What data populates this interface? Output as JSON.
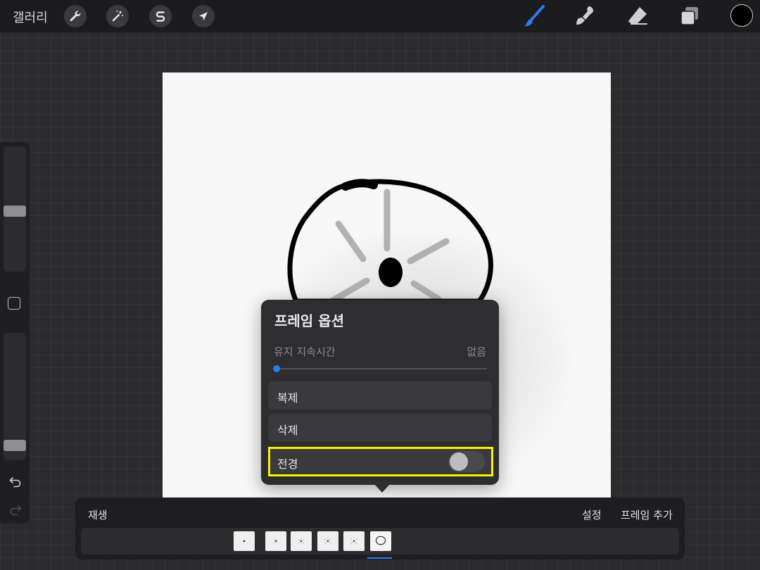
{
  "toolbar": {
    "gallery_label": "갤러리",
    "left_tools": [
      "wrench-icon",
      "magic-wand-icon",
      "selection-s-icon",
      "transform-arrow-icon"
    ],
    "right_tools": [
      "brush-icon",
      "smudge-icon",
      "eraser-icon",
      "layers-icon"
    ],
    "active_tool": "brush-icon",
    "accent_color": "#2a7bf4",
    "current_color": "#000000"
  },
  "sidebar": {
    "brush_size_level": 0.48,
    "opacity_level": 0.08,
    "icons": [
      "modify-square-icon",
      "undo-icon",
      "redo-icon"
    ]
  },
  "frame_options": {
    "title": "프레임 옵션",
    "hold_duration_label": "유지 지속시간",
    "hold_duration_value": "없음",
    "hold_duration_level": 0,
    "duplicate_label": "복제",
    "delete_label": "삭제",
    "foreground_label": "전경",
    "foreground_enabled": false,
    "highlight_color": "#f8f200"
  },
  "timeline": {
    "play_label": "재생",
    "settings_label": "설정",
    "add_frame_label": "프레임 추가",
    "frames": [
      {
        "index": 1,
        "selected": false
      },
      {
        "index": 2,
        "selected": false
      },
      {
        "index": 3,
        "selected": false
      },
      {
        "index": 4,
        "selected": false
      },
      {
        "index": 5,
        "selected": false
      },
      {
        "index": 6,
        "selected": true
      }
    ]
  }
}
